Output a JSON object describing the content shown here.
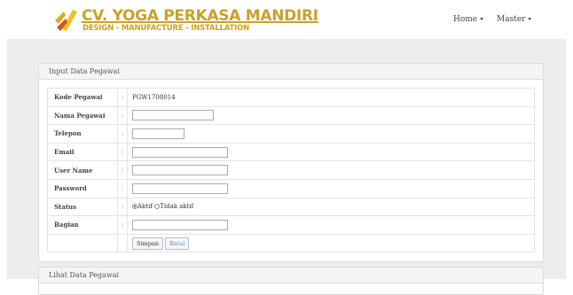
{
  "brand": {
    "title": "CV. YOGA PERKASA MANDIRI",
    "subtitle": "DESIGN - MANUFACTURE - INSTALLATION",
    "color": "#c9a227"
  },
  "nav": {
    "items": [
      {
        "label": "Home"
      },
      {
        "label": "Master"
      }
    ]
  },
  "form_panel": {
    "heading": "Input Data Pegawai",
    "fields": [
      {
        "label": "Kode Pegawai",
        "sep": ":",
        "value": "PGW1708014"
      },
      {
        "label": "Nama Pegawai",
        "sep": ":",
        "value": ""
      },
      {
        "label": "Telepon",
        "sep": ":",
        "value": ""
      },
      {
        "label": "Email",
        "sep": ":",
        "value": ""
      },
      {
        "label": "User Name",
        "sep": ":",
        "value": ""
      },
      {
        "label": "Password",
        "sep": ":",
        "value": ""
      },
      {
        "label": "Status",
        "sep": ":",
        "options": [
          "Aktif",
          "Tidak aktif"
        ],
        "selected": "Aktif"
      },
      {
        "label": "Bagian",
        "sep": ":",
        "value": ""
      }
    ],
    "buttons": {
      "save": "Simpan",
      "cancel": "Batal"
    }
  },
  "list_panel": {
    "heading": "Lihat Data Pegawai"
  }
}
